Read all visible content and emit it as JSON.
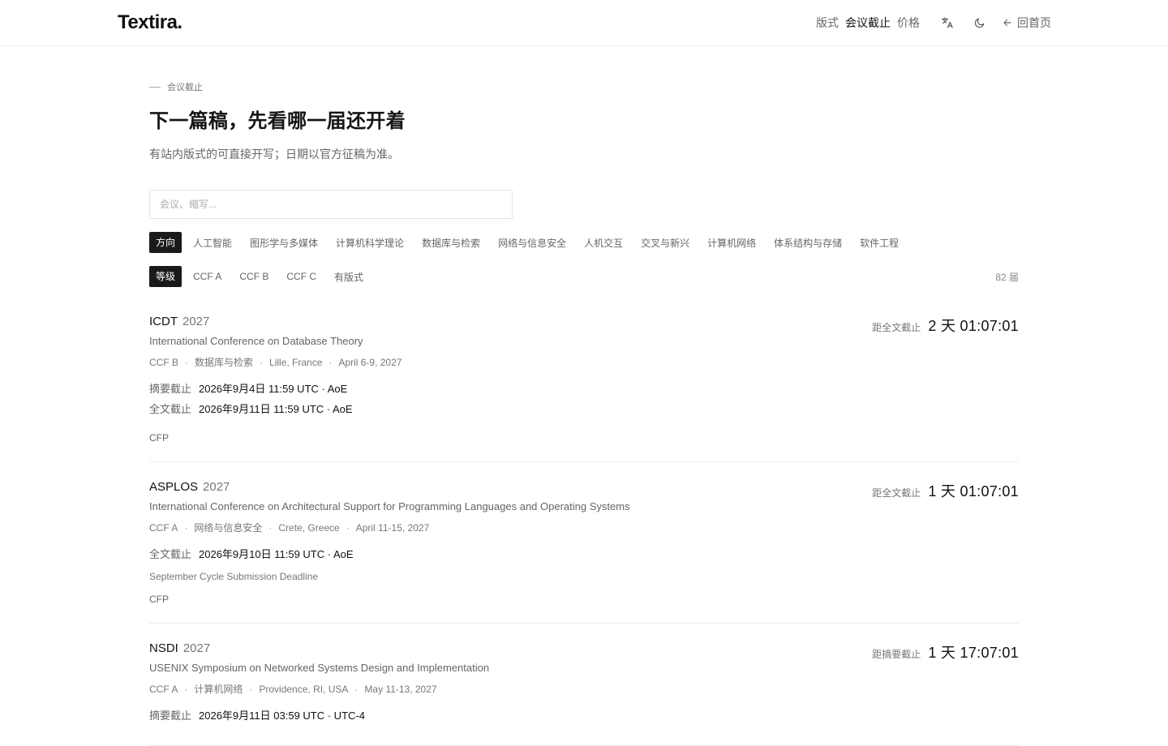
{
  "header": {
    "logo": "Textira",
    "logo_dot": ".",
    "nav": [
      "版式",
      "会议截止",
      "价格"
    ],
    "back": "回首页"
  },
  "page": {
    "eyebrow": "会议截止",
    "title": "下一篇稿，先看哪一届还开着",
    "subtitle": "有站内版式的可直接开写；日期以官方征稿为准。",
    "search_placeholder": "会议、缩写..."
  },
  "filters": {
    "direction_label": "方向",
    "directions": [
      "人工智能",
      "图形学与多媒体",
      "计算机科学理论",
      "数据库与检索",
      "网络与信息安全",
      "人机交互",
      "交叉与新兴",
      "计算机网络",
      "体系结构与存储",
      "软件工程"
    ],
    "level_label": "等级",
    "levels": [
      "CCF A",
      "CCF B",
      "CCF C",
      "有版式"
    ],
    "count": "82 届"
  },
  "conferences": [
    {
      "abbr": "ICDT",
      "year": "2027",
      "full": "International Conference on Database Theory",
      "rank": "CCF B",
      "area": "数据库与检索",
      "location": "Lille, France",
      "dates": "April 6-9, 2027",
      "countdown_label": "距全文截止",
      "countdown": "2 天 01:07:01",
      "deadlines": [
        {
          "label": "摘要截止",
          "value": "2026年9月4日 11:59 UTC · AoE"
        },
        {
          "label": "全文截止",
          "value": "2026年9月11日 11:59 UTC · AoE"
        }
      ],
      "note": "",
      "cfp": "CFP"
    },
    {
      "abbr": "ASPLOS",
      "year": "2027",
      "full": "International Conference on Architectural Support for Programming Languages and Operating Systems",
      "rank": "CCF A",
      "area": "网络与信息安全",
      "location": "Crete, Greece",
      "dates": "April 11-15, 2027",
      "countdown_label": "距全文截止",
      "countdown": "1 天 01:07:01",
      "deadlines": [
        {
          "label": "全文截止",
          "value": "2026年9月10日 11:59 UTC · AoE"
        }
      ],
      "note": "September Cycle Submission Deadline",
      "cfp": "CFP"
    },
    {
      "abbr": "NSDI",
      "year": "2027",
      "full": "USENIX Symposium on Networked Systems Design and Implementation",
      "rank": "CCF A",
      "area": "计算机网络",
      "location": "Providence, RI, USA",
      "dates": "May 11-13, 2027",
      "countdown_label": "距摘要截止",
      "countdown": "1 天 17:07:01",
      "deadlines": [
        {
          "label": "摘要截止",
          "value": "2026年9月11日 03:59 UTC · UTC-4"
        }
      ],
      "note": "",
      "cfp": ""
    }
  ]
}
